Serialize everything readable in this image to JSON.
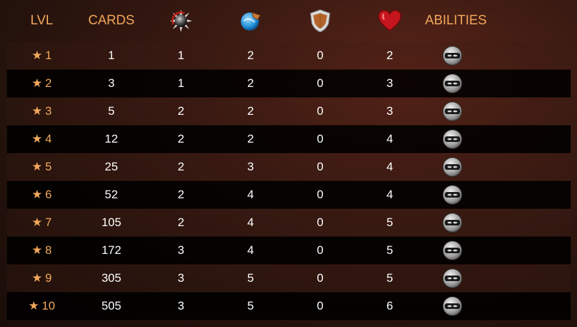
{
  "header": {
    "lvl": "LVL",
    "cards": "CARDS",
    "abilities": "ABILITIES",
    "icons": [
      "melee-attack-icon",
      "speed-icon",
      "armor-icon",
      "health-icon"
    ]
  },
  "colors": {
    "accent": "#f4a85c",
    "row_dark": "#0a0605",
    "text": "#ffffff"
  },
  "rows": [
    {
      "lvl": "1",
      "cards": "1",
      "atk": "1",
      "spd": "2",
      "arm": "0",
      "hp": "2",
      "ability": "masked-face-icon"
    },
    {
      "lvl": "2",
      "cards": "3",
      "atk": "1",
      "spd": "2",
      "arm": "0",
      "hp": "3",
      "ability": "masked-face-icon"
    },
    {
      "lvl": "3",
      "cards": "5",
      "atk": "2",
      "spd": "2",
      "arm": "0",
      "hp": "3",
      "ability": "masked-face-icon"
    },
    {
      "lvl": "4",
      "cards": "12",
      "atk": "2",
      "spd": "2",
      "arm": "0",
      "hp": "4",
      "ability": "masked-face-icon"
    },
    {
      "lvl": "5",
      "cards": "25",
      "atk": "2",
      "spd": "3",
      "arm": "0",
      "hp": "4",
      "ability": "masked-face-icon"
    },
    {
      "lvl": "6",
      "cards": "52",
      "atk": "2",
      "spd": "4",
      "arm": "0",
      "hp": "4",
      "ability": "masked-face-icon"
    },
    {
      "lvl": "7",
      "cards": "105",
      "atk": "2",
      "spd": "4",
      "arm": "0",
      "hp": "5",
      "ability": "masked-face-icon"
    },
    {
      "lvl": "8",
      "cards": "172",
      "atk": "3",
      "spd": "4",
      "arm": "0",
      "hp": "5",
      "ability": "masked-face-icon"
    },
    {
      "lvl": "9",
      "cards": "305",
      "atk": "3",
      "spd": "5",
      "arm": "0",
      "hp": "5",
      "ability": "masked-face-icon"
    },
    {
      "lvl": "10",
      "cards": "505",
      "atk": "3",
      "spd": "5",
      "arm": "0",
      "hp": "6",
      "ability": "masked-face-icon"
    }
  ]
}
